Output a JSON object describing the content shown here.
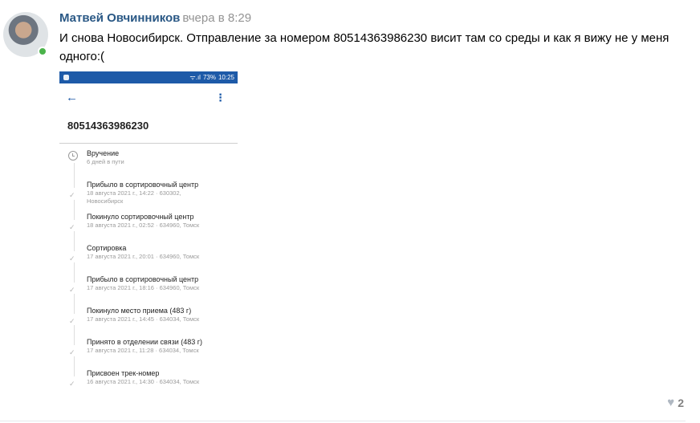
{
  "post": {
    "author": "Матвей Овчинников",
    "time": "вчера в 8:29",
    "text": "И снова Новосибирск. Отправление за номером 80514363986230 висит там со среды и как я вижу не у меня одного:(",
    "likes": "2"
  },
  "screenshot": {
    "status": {
      "signal": "ᯤ.ıl",
      "battery": "73%",
      "clock": "10:25"
    },
    "track_number": "80514363986230",
    "events": [
      {
        "title": "Вручение",
        "sub": "6 дней в пути",
        "icon": "clock-icon"
      },
      {
        "title": "Прибыло в сортировочный центр",
        "sub": "18 августа 2021 г., 14:22 · 630302,",
        "sub2": "Новосибирск",
        "icon": "check-icon"
      },
      {
        "title": "Покинуло сортировочный центр",
        "sub": "18 августа 2021 г., 02:52 · 634960, Томск",
        "icon": "check-icon"
      },
      {
        "title": "Сортировка",
        "sub": "17 августа 2021 г., 20:01 · 634960, Томск",
        "icon": "check-icon"
      },
      {
        "title": "Прибыло в сортировочный центр",
        "sub": "17 августа 2021 г., 18:16 · 634960, Томск",
        "icon": "check-icon"
      },
      {
        "title": "Покинуло место приема (483 г)",
        "sub": "17 августа 2021 г., 14:45 · 634034, Томск",
        "icon": "check-icon"
      },
      {
        "title": "Принято в отделении связи (483 г)",
        "sub": "17 августа 2021 г., 11:28 · 634034, Томск",
        "icon": "check-icon"
      },
      {
        "title": "Присвоен трек-номер",
        "sub": "16 августа 2021 г., 14:30 · 634034, Томск",
        "icon": "check-icon"
      }
    ]
  },
  "colors": {
    "author": "#2a5885",
    "online": "#4bb34b",
    "statusbar": "#1d5aa8"
  }
}
